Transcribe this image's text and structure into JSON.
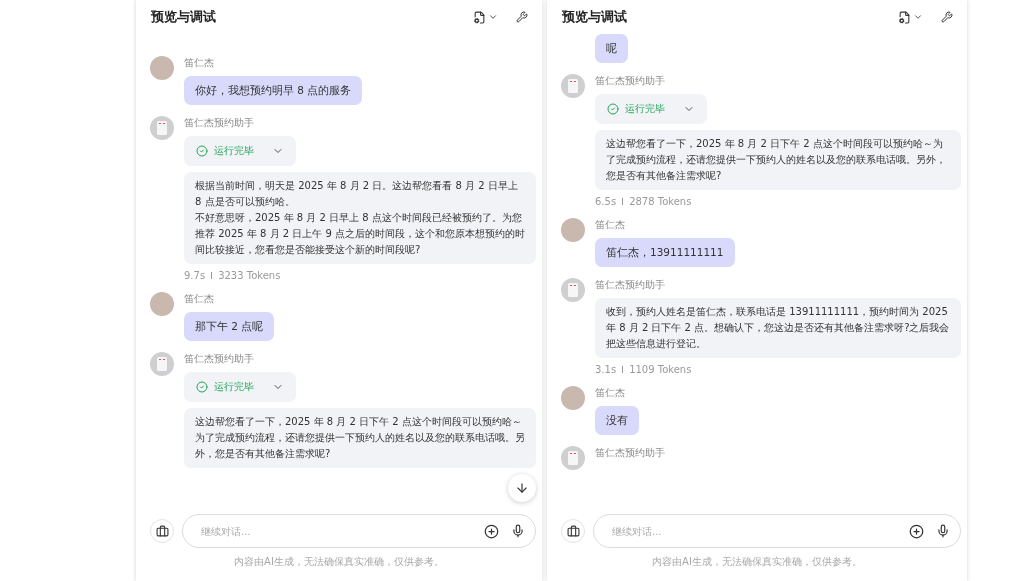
{
  "panels": [
    {
      "title": "预览与调试",
      "scroll_button": true,
      "messages": [
        {
          "kind": "user",
          "sender": "笛仁杰",
          "text": "你好，我想预约明早 8 点的服务"
        },
        {
          "kind": "assistant",
          "sender": "笛仁杰预约助手",
          "status": {
            "label": "运行完毕",
            "expanded": false
          },
          "paragraphs": [
            "根据当前时间，明天是 2025 年 8 月 2 日。这边帮您看看 8 月 2 日早上 8 点是否可以预约哈。",
            "不好意思呀，2025 年 8 月 2 日早上 8 点这个时间段已经被预约了。为您推荐 2025 年 8 月 2 日上午 9 点之后的时间段，这个和您原本想预约的时间比较接近，您看您是否能接受这个新的时间段呢?"
          ],
          "duration": "9.7s",
          "tokens": "3233 Tokens"
        },
        {
          "kind": "user",
          "sender": "笛仁杰",
          "text": "那下午 2 点呢"
        },
        {
          "kind": "assistant",
          "sender": "笛仁杰预约助手",
          "status": {
            "label": "运行完毕",
            "expanded": false
          },
          "text": "这边帮您看了一下，2025 年 8 月 2 日下午 2 点这个时间段可以预约哈～为了完成预约流程，还请您提供一下预约人的姓名以及您的联系电话哦。另外，您是否有其他备注需求呢?"
        }
      ],
      "input": {
        "placeholder": "继续对话..."
      },
      "disclaimer": "内容由AI生成，无法确保真实准确，仅供参考。"
    },
    {
      "title": "预览与调试",
      "scroll_button": false,
      "messages": [
        {
          "kind": "user",
          "text": "呢"
        },
        {
          "kind": "assistant",
          "sender": "笛仁杰预约助手",
          "status": {
            "label": "运行完毕",
            "expanded": false
          },
          "text": "这边帮您看了一下，2025 年 8 月 2 日下午 2 点这个时间段可以预约哈～为了完成预约流程，还请您提供一下预约人的姓名以及您的联系电话哦。另外，您是否有其他备注需求呢?",
          "duration": "6.5s",
          "tokens": "2878 Tokens"
        },
        {
          "kind": "user",
          "sender": "笛仁杰",
          "text": "笛仁杰，13911111111"
        },
        {
          "kind": "assistant",
          "sender": "笛仁杰预约助手",
          "text": "收到，预约人姓名是笛仁杰，联系电话是 13911111111，预约时间为 2025 年 8 月 2 日下午 2 点。想确认下，您这边是否还有其他备注需求呀?之后我会把这些信息进行登记。",
          "duration": "3.1s",
          "tokens": "1109 Tokens"
        },
        {
          "kind": "user",
          "sender": "笛仁杰",
          "text": "没有"
        },
        {
          "kind": "assistant",
          "sender": "笛仁杰预约助手"
        }
      ],
      "input": {
        "placeholder": "继续对话..."
      },
      "disclaimer": "内容由AI生成，无法确保真实准确，仅供参考。"
    }
  ]
}
